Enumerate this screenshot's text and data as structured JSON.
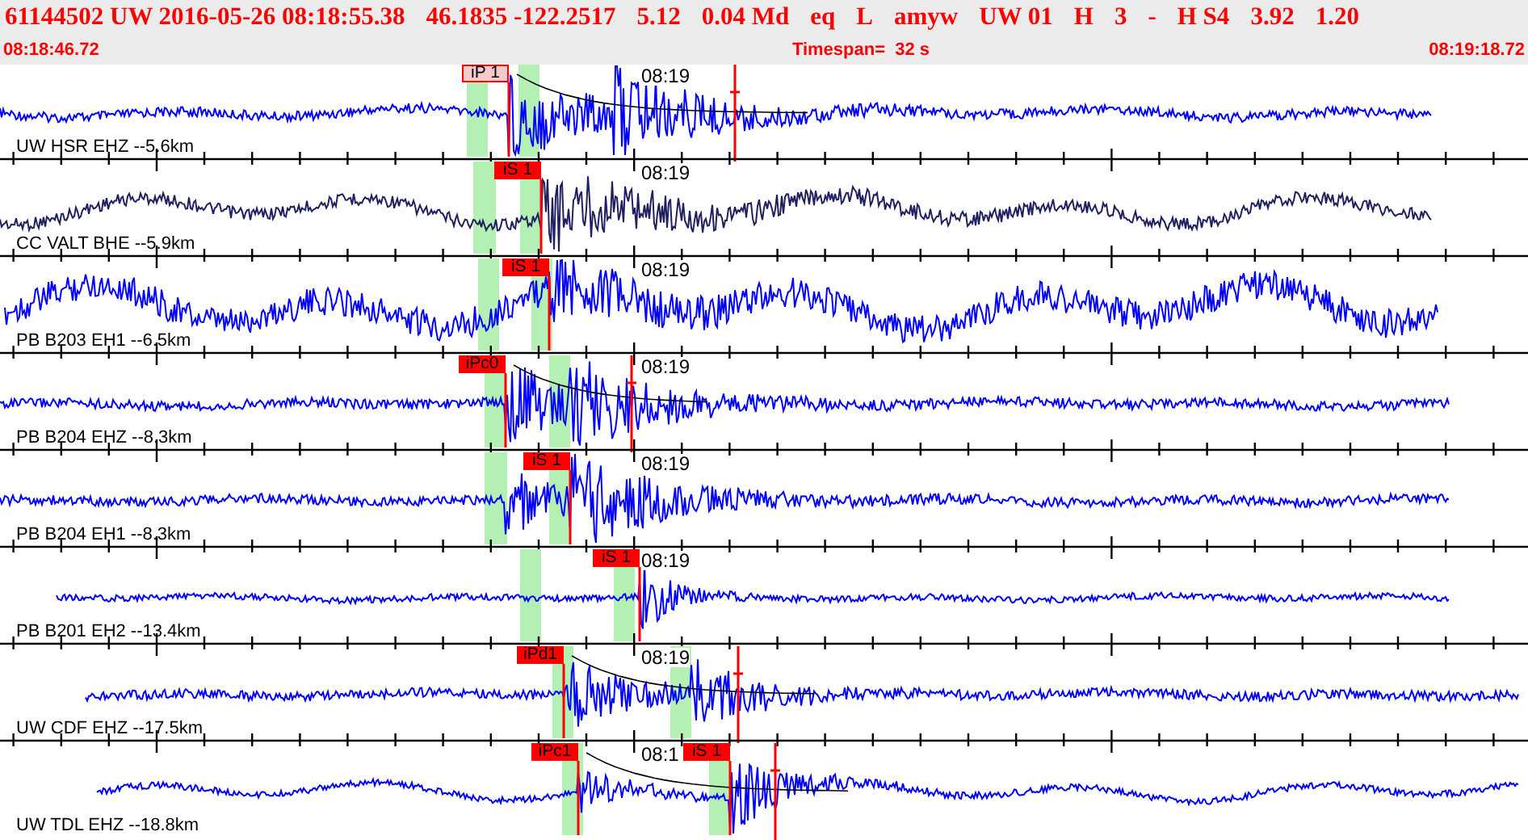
{
  "header": {
    "summary": [
      "61144502 UW 2016-05-26 08:18:55.38",
      "46.1835 -122.2517",
      "5.12",
      "0.04 Md",
      "eq",
      "L",
      "amyw",
      "UW 01",
      "H",
      "3",
      "-",
      "H S4",
      "3.92",
      "1.20"
    ],
    "start_time": "08:18:46.72",
    "timespan": "Timespan=  32 s",
    "end_time": "08:19:18.72"
  },
  "rows": [
    {
      "station": "UW HSR EHZ --5.6km",
      "time_label": "08:19",
      "color": "#0000ff",
      "picks": [
        {
          "label": "iP 1",
          "kind": "faded"
        }
      ]
    },
    {
      "station": "CC VALT BHE --5.9km",
      "time_label": "08:19",
      "color": "#202060",
      "picks": [
        {
          "label": "iS 1",
          "kind": "solid"
        }
      ]
    },
    {
      "station": "PB B203 EH1 --6.5km",
      "time_label": "08:19",
      "color": "#0000ff",
      "picks": [
        {
          "label": "iS 1",
          "kind": "solid"
        }
      ]
    },
    {
      "station": "PB B204 EHZ --8.3km",
      "time_label": "08:19",
      "color": "#0000ff",
      "picks": [
        {
          "label": "iPc0",
          "kind": "solid"
        }
      ]
    },
    {
      "station": "PB B204 EH1 --8.3km",
      "time_label": "08:19",
      "color": "#0000ff",
      "picks": [
        {
          "label": "iS 1",
          "kind": "solid"
        }
      ]
    },
    {
      "station": "PB B201 EH2 --13.4km",
      "time_label": "08:19",
      "color": "#0000ff",
      "picks": [
        {
          "label": "iS 1",
          "kind": "solid"
        }
      ]
    },
    {
      "station": "UW CDF EHZ --17.5km",
      "time_label": "08:19",
      "color": "#0000ff",
      "picks": [
        {
          "label": "iPd1",
          "kind": "solid"
        }
      ]
    },
    {
      "station": "UW TDL EHZ --18.8km",
      "time_label": "08:1",
      "color": "#0000ff",
      "picks": [
        {
          "label": "iPc1",
          "kind": "solid"
        },
        {
          "label": "iS 1",
          "kind": "solid"
        }
      ]
    }
  ]
}
